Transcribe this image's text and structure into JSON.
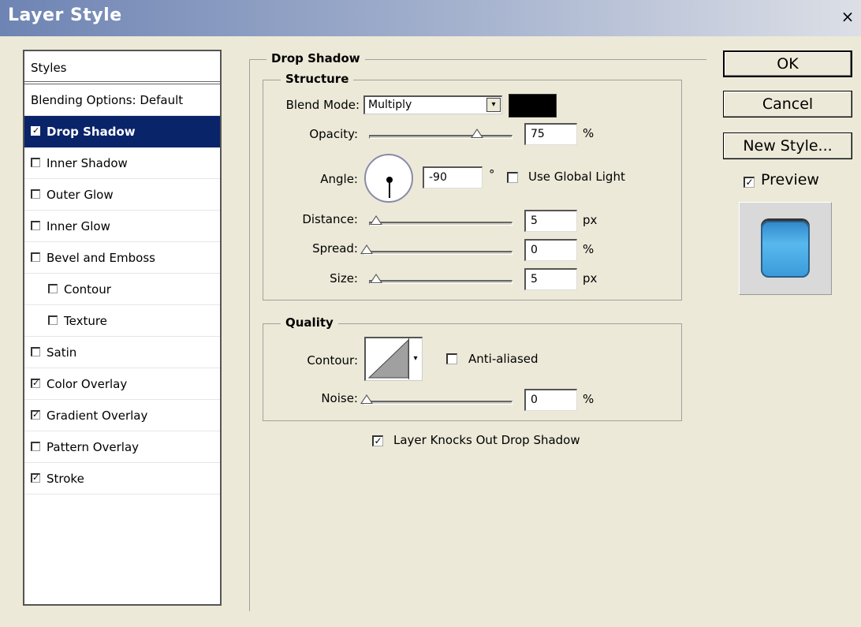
{
  "window": {
    "title": "Layer Style",
    "close_glyph": "×"
  },
  "styles_panel": {
    "header": "Styles",
    "items": [
      {
        "label": "Blending Options: Default",
        "checkbox": false,
        "checked": false,
        "indent": false,
        "selected": false
      },
      {
        "label": "Drop Shadow",
        "checkbox": true,
        "checked": true,
        "indent": false,
        "selected": true
      },
      {
        "label": "Inner Shadow",
        "checkbox": true,
        "checked": false,
        "indent": false,
        "selected": false
      },
      {
        "label": "Outer Glow",
        "checkbox": true,
        "checked": false,
        "indent": false,
        "selected": false
      },
      {
        "label": "Inner Glow",
        "checkbox": true,
        "checked": false,
        "indent": false,
        "selected": false
      },
      {
        "label": "Bevel and Emboss",
        "checkbox": true,
        "checked": false,
        "indent": false,
        "selected": false
      },
      {
        "label": "Contour",
        "checkbox": true,
        "checked": false,
        "indent": true,
        "selected": false
      },
      {
        "label": "Texture",
        "checkbox": true,
        "checked": false,
        "indent": true,
        "selected": false
      },
      {
        "label": "Satin",
        "checkbox": true,
        "checked": false,
        "indent": false,
        "selected": false
      },
      {
        "label": "Color Overlay",
        "checkbox": true,
        "checked": true,
        "indent": false,
        "selected": false
      },
      {
        "label": "Gradient Overlay",
        "checkbox": true,
        "checked": true,
        "indent": false,
        "selected": false
      },
      {
        "label": "Pattern Overlay",
        "checkbox": true,
        "checked": false,
        "indent": false,
        "selected": false
      },
      {
        "label": "Stroke",
        "checkbox": true,
        "checked": true,
        "indent": false,
        "selected": false
      }
    ]
  },
  "drop_shadow": {
    "title": "Drop Shadow",
    "structure": {
      "title": "Structure",
      "blend_mode_label": "Blend Mode:",
      "blend_mode_value": "Multiply",
      "shadow_color": "#000000",
      "opacity_label": "Opacity:",
      "opacity_value": "75",
      "opacity_unit": "%",
      "opacity_level": 0.75,
      "angle_label": "Angle:",
      "angle_value": "-90",
      "angle_unit": "°",
      "use_global_light_label": "Use Global Light",
      "use_global_light_checked": false,
      "distance_label": "Distance:",
      "distance_value": "5",
      "distance_unit": "px",
      "spread_label": "Spread:",
      "spread_value": "0",
      "spread_unit": "%",
      "size_label": "Size:",
      "size_value": "5",
      "size_unit": "px"
    },
    "quality": {
      "title": "Quality",
      "contour_label": "Contour:",
      "anti_aliased_label": "Anti-aliased",
      "anti_aliased_checked": false,
      "noise_label": "Noise:",
      "noise_value": "0",
      "noise_unit": "%"
    },
    "knockout_label": "Layer Knocks Out Drop Shadow",
    "knockout_checked": true
  },
  "buttons": {
    "ok": "OK",
    "cancel": "Cancel",
    "new_style": "New Style..."
  },
  "preview": {
    "label": "Preview",
    "checked": true
  },
  "check_glyph": "✓",
  "select_arrow_glyph": "▾"
}
